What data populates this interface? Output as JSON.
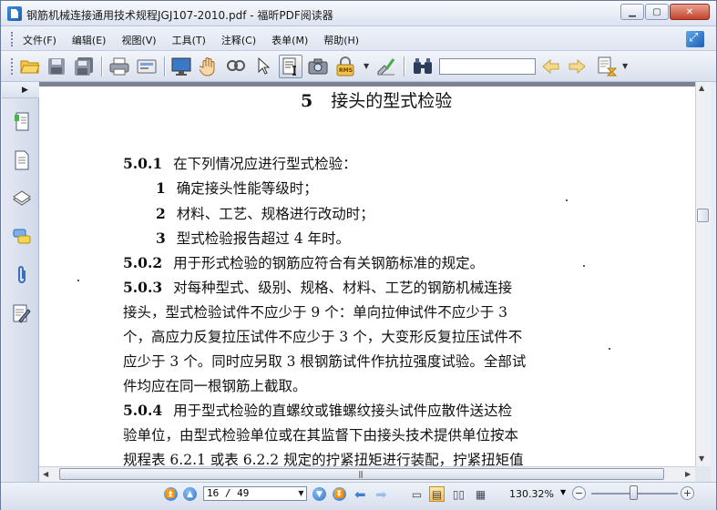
{
  "window": {
    "title": "钢筋机械连接通用技术规程JGJ107-2010.pdf - 福昕PDF阅读器",
    "min_label": "▁",
    "max_label": "▢",
    "close_label": "✕"
  },
  "menu": [
    "文件(F)",
    "编辑(E)",
    "视图(V)",
    "工具(T)",
    "注释(C)",
    "表单(M)",
    "帮助(H)"
  ],
  "toolbar": {
    "icons": [
      "open-folder-icon",
      "save-icon",
      "save-all-icon",
      "print-icon",
      "scan-icon",
      "fullscreen-icon",
      "hand-tool-icon",
      "zoom-glass-icon",
      "select-arrow-icon",
      "text-select-icon",
      "snapshot-icon",
      "rms-icon",
      "sign-icon",
      "find-icon",
      "prev-result-icon",
      "next-result-icon",
      "highlight-icon"
    ],
    "rms_label": "RMS",
    "search_value": ""
  },
  "document": {
    "heading_num": "5",
    "heading_text": "接头的型式检验",
    "lines": [
      {
        "num": "5.0.1",
        "text": "在下列情况应进行型式检验："
      },
      {
        "num": "1",
        "text": "确定接头性能等级时；"
      },
      {
        "num": "2",
        "text": "材料、工艺、规格进行改动时；"
      },
      {
        "num": "3",
        "text": "型式检验报告超过 4 年时。"
      },
      {
        "num": "5.0.2",
        "text": "用于形式检验的钢筋应符合有关钢筋标准的规定。"
      },
      {
        "num": "5.0.3",
        "text": "对每种型式、级别、规格、材料、工艺的钢筋机械连接"
      },
      {
        "num": "",
        "text": "接头，型式检验试件不应少于 9 个：单向拉伸试件不应少于 3"
      },
      {
        "num": "",
        "text": "个，高应力反复拉压试件不应少于 3 个，大变形反复拉压试件不"
      },
      {
        "num": "",
        "text": "应少于 3 个。同时应另取 3 根钢筋试件作抗拉强度试验。全部试"
      },
      {
        "num": "",
        "text": "件均应在同一根钢筋上截取。"
      },
      {
        "num": "5.0.4",
        "text": "用于型式检验的直螺纹或锥螺纹接头试件应散件送达检"
      },
      {
        "num": "",
        "text": "验单位，由型式检验单位或在其监督下由接头技术提供单位按本"
      },
      {
        "num": "",
        "text": "规程表 6.2.1 或表 6.2.2 规定的拧紧扭矩进行装配，拧紧扭矩值"
      }
    ]
  },
  "statusbar": {
    "page_value": "16 / 49",
    "zoom_value": "130.32%",
    "zoom_level_fraction": 0.45
  }
}
